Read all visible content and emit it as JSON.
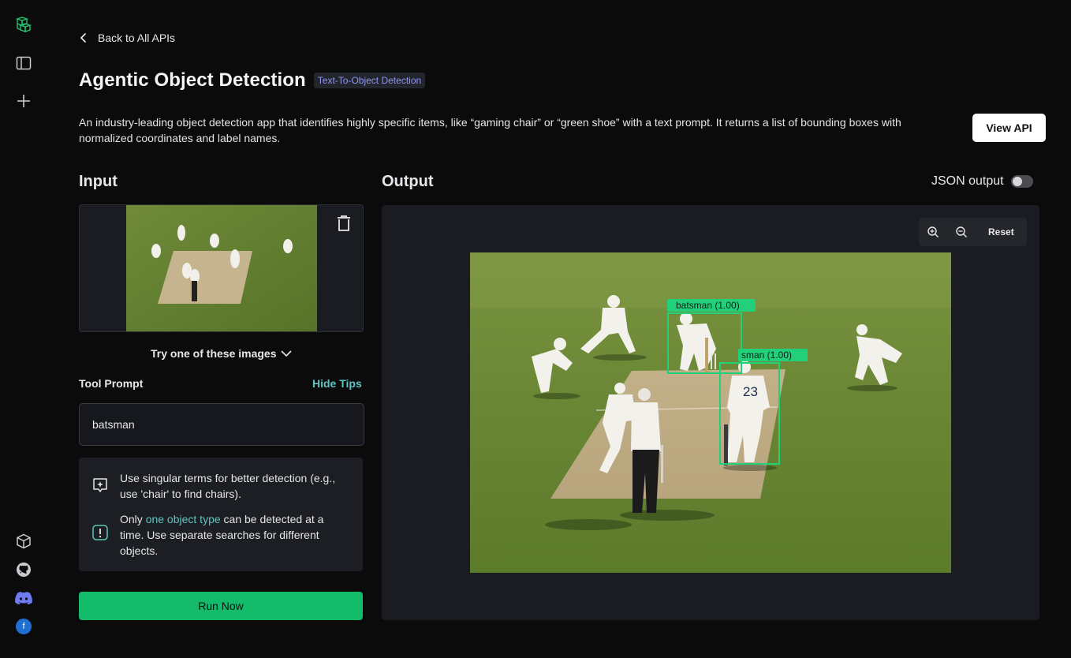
{
  "nav": {
    "back_label": "Back to All APIs",
    "icons": [
      "logo-icon",
      "sidebar-toggle-icon",
      "plus-icon",
      "cube-icon",
      "github-icon",
      "discord-icon",
      "avatar"
    ],
    "avatar_initial": "f"
  },
  "header": {
    "title": "Agentic Object Detection",
    "tag": "Text-To-Object Detection",
    "description": "An industry-leading object detection app that identifies highly specific items, like “gaming chair” or “green shoe” with a text prompt. It returns a list of bounding boxes with normalized coordinates and label names.",
    "view_api_label": "View API"
  },
  "input": {
    "heading": "Input",
    "try_images_label": "Try one of these images",
    "tool_prompt_label": "Tool Prompt",
    "hide_tips_label": "Hide Tips",
    "prompt_value": "batsman",
    "tips": {
      "tip1": "Use singular terms for better detection (e.g., use 'chair' to find chairs).",
      "tip2_prefix": "Only ",
      "tip2_accent": "one object type",
      "tip2_suffix": " can be detected at a time. Use separate searches for different objects."
    },
    "run_label": "Run Now"
  },
  "output": {
    "heading": "Output",
    "json_toggle_label": "JSON output",
    "json_toggle_on": false,
    "reset_label": "Reset",
    "detections": [
      {
        "label": "batsman (1.00)"
      },
      {
        "label": "sman (1.00)"
      }
    ]
  },
  "colors": {
    "accent_green": "#13bb6a",
    "bbox_green": "#22d07a",
    "link_teal": "#5ec5c0",
    "tag_text": "#8f95f0"
  }
}
